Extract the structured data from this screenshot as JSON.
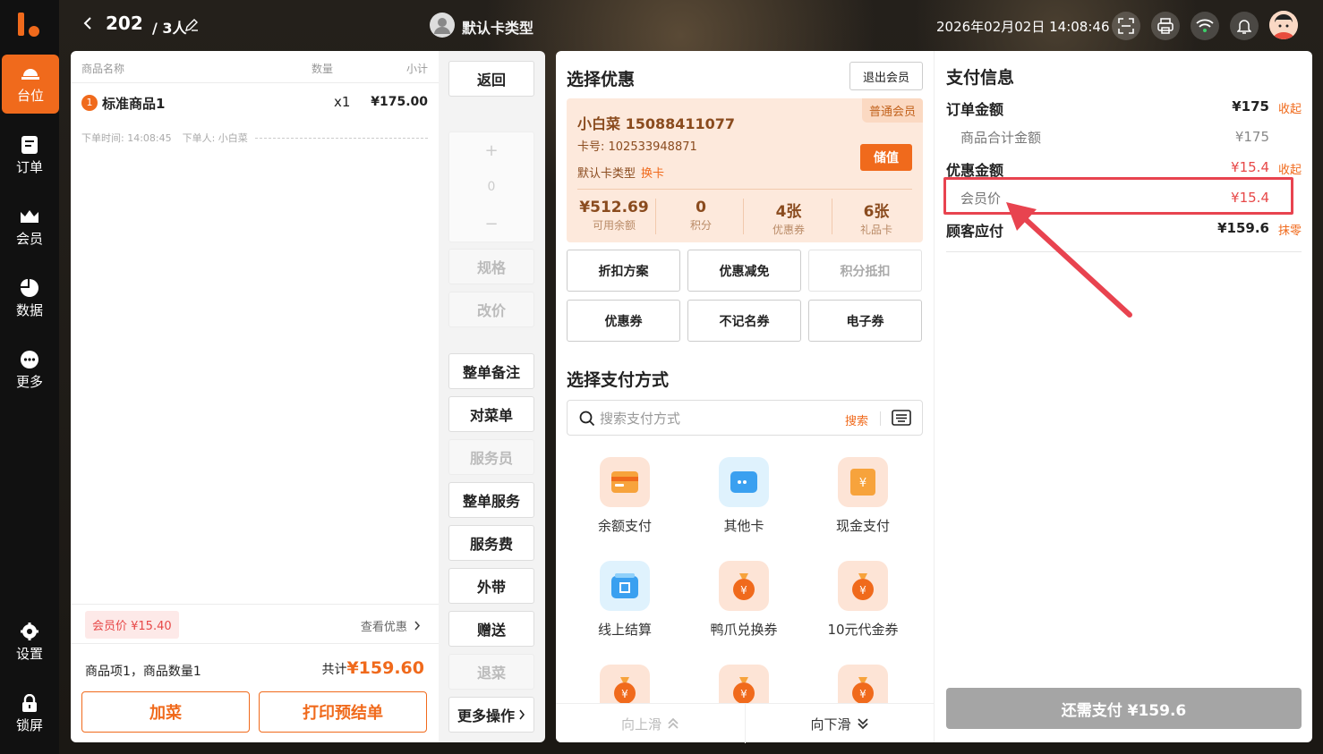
{
  "nav": {
    "items": [
      {
        "label": "台位",
        "icon": "table-icon"
      },
      {
        "label": "订单",
        "icon": "order-icon"
      },
      {
        "label": "会员",
        "icon": "crown-icon"
      },
      {
        "label": "数据",
        "icon": "pie-chart-icon"
      },
      {
        "label": "更多",
        "icon": "more-icon"
      },
      {
        "label": "设置",
        "icon": "gear-icon"
      },
      {
        "label": "锁屏",
        "icon": "lock-icon"
      }
    ]
  },
  "header": {
    "table_no": "202",
    "people": "/ 3人",
    "member_type": "默认卡类型",
    "datetime": "2026年02月02日 14:08:46"
  },
  "order": {
    "columns": {
      "name": "商品名称",
      "qty": "数量",
      "subtotal": "小计"
    },
    "items": [
      {
        "index": "1",
        "name": "标准商品1",
        "qty": "x1",
        "price": "¥175.00"
      }
    ],
    "meta_time": "下单时间: 14:08:45",
    "meta_user": "下单人: 小白菜",
    "discount_tag": "会员价 ¥15.40",
    "view_discount": "查看优惠",
    "summary_left": "商品项1，商品数量1",
    "summary_total_label": "共计",
    "summary_total": "¥159.60",
    "add_dish": "加菜",
    "print_pre": "打印预结单"
  },
  "actions": {
    "back": "返回",
    "plus": "+",
    "count": "0",
    "minus": "−",
    "spec": "规格",
    "change_price": "改价",
    "order_note": "整单备注",
    "check_dishes": "对菜单",
    "waiter": "服务员",
    "whole_service": "整单服务",
    "service_fee": "服务费",
    "takeaway": "外带",
    "gift": "赠送",
    "return_dish": "退菜",
    "more_ops": "更多操作"
  },
  "discounts": {
    "title": "选择优惠",
    "exit_member": "退出会员",
    "member": {
      "name_phone": "小白菜  15088411077",
      "level": "普通会员",
      "card_no": "卡号: 102533948871",
      "card_type": "默认卡类型",
      "change_card": "换卡",
      "recharge": "储值",
      "stats": [
        {
          "value": "¥512.69",
          "label": "可用余额"
        },
        {
          "value": "0",
          "label": "积分"
        },
        {
          "value": "4张",
          "label": "优惠券"
        },
        {
          "value": "6张",
          "label": "礼品卡"
        }
      ]
    },
    "buttons": [
      {
        "label": "折扣方案",
        "disabled": false
      },
      {
        "label": "优惠减免",
        "disabled": false
      },
      {
        "label": "积分抵扣",
        "disabled": true
      },
      {
        "label": "优惠券",
        "disabled": false
      },
      {
        "label": "不记名券",
        "disabled": false
      },
      {
        "label": "电子券",
        "disabled": false
      }
    ]
  },
  "payment": {
    "title": "选择支付方式",
    "search_placeholder": "搜索支付方式",
    "search_btn": "搜索",
    "methods": [
      {
        "label": "余额支付",
        "color": "#fde4d6"
      },
      {
        "label": "其他卡",
        "color": "#dff2fd"
      },
      {
        "label": "现金支付",
        "color": "#fde4d6"
      },
      {
        "label": "线上结算",
        "color": "#dff2fd"
      },
      {
        "label": "鸭爪兑换券",
        "color": "#fde4d6"
      },
      {
        "label": "10元代金券",
        "color": "#fde4d6"
      }
    ],
    "scroll_up": "向上滑",
    "scroll_down": "向下滑"
  },
  "pay_info": {
    "title": "支付信息",
    "order_amount_label": "订单金额",
    "order_amount": "¥175",
    "collapse1": "收起",
    "goods_total_label": "商品合计金额",
    "goods_total": "¥175",
    "discount_label": "优惠金额",
    "discount_amount": "¥15.4",
    "collapse2": "收起",
    "member_price_label": "会员价",
    "member_price": "¥15.4",
    "due_label": "顾客应付",
    "due_amount": "¥159.6",
    "round_off": "抹零",
    "pay_button": "还需支付 ¥159.6"
  },
  "colors": {
    "accent": "#f06a1c",
    "highlight": "#e8434f"
  }
}
